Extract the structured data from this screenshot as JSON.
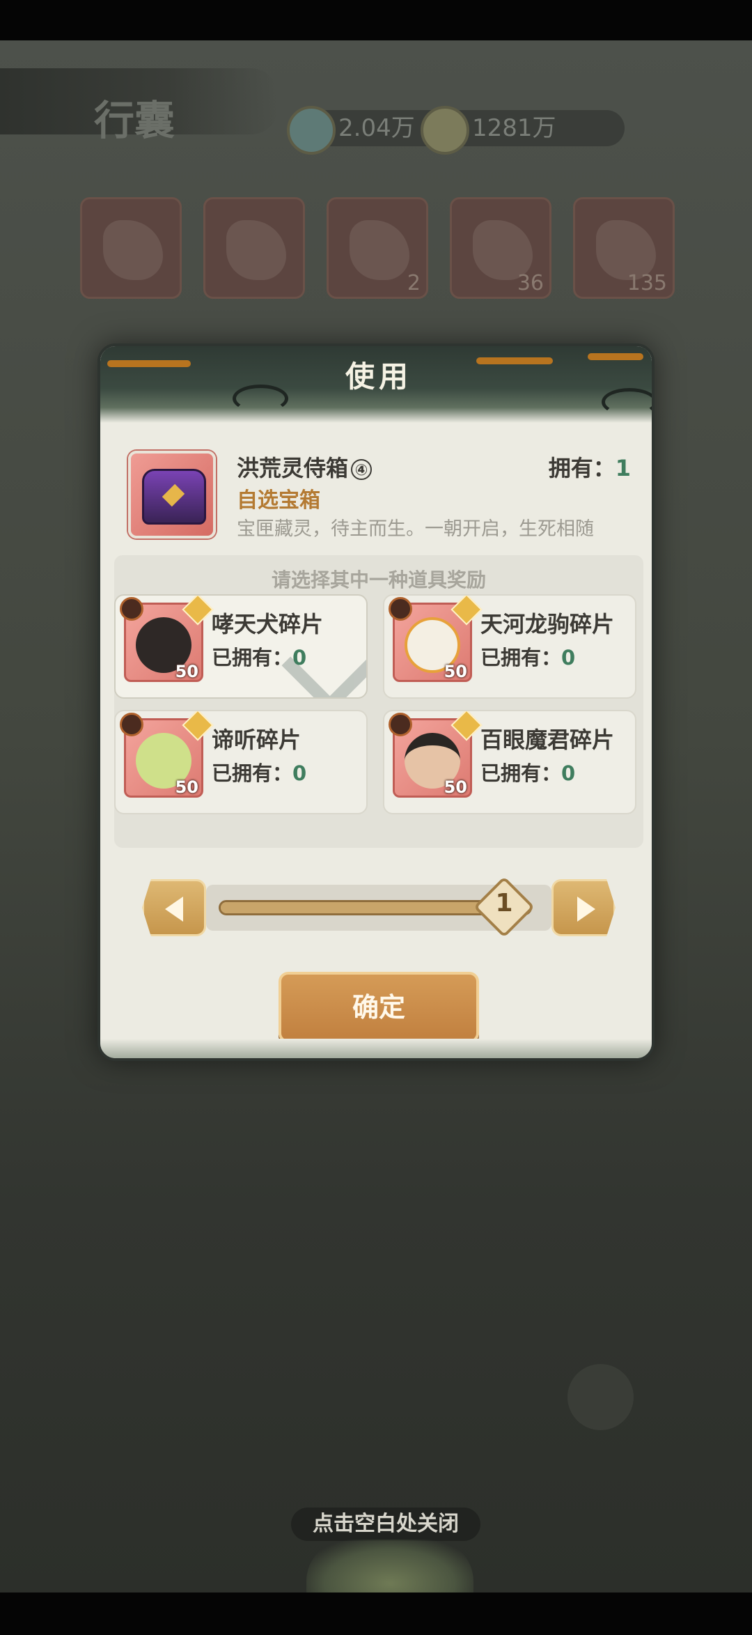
{
  "background": {
    "title": "行囊",
    "currency_1": "2.04万",
    "currency_2": "1281万",
    "slot_counts": [
      "",
      "",
      "2",
      "36",
      "135"
    ]
  },
  "dialog": {
    "title": "使用",
    "item": {
      "name": "洪荒灵侍箱",
      "badge": "④",
      "owned_label": "拥有：",
      "owned_value": "1",
      "type": "自选宝箱",
      "description": "宝匣藏灵，待主而生。一朝开启，生死相随"
    },
    "choice_title": "请选择其中一种道具奖励",
    "rewards": [
      {
        "name": "哮天犬碎片",
        "owned_label": "已拥有：",
        "owned_value": "0",
        "qty": "50",
        "selected": true
      },
      {
        "name": "天河龙驹碎片",
        "owned_label": "已拥有：",
        "owned_value": "0",
        "qty": "50",
        "selected": false
      },
      {
        "name": "谛听碎片",
        "owned_label": "已拥有：",
        "owned_value": "0",
        "qty": "50",
        "selected": false
      },
      {
        "name": "百眼魔君碎片",
        "owned_label": "已拥有：",
        "owned_value": "0",
        "qty": "50",
        "selected": false
      }
    ],
    "slider": {
      "value": "1",
      "fraction": 1.0
    },
    "confirm_label": "确定"
  },
  "close_hint": "点击空白处关闭",
  "colors": {
    "accent_gold": "#c1803f",
    "owned_green": "#3f7d5e",
    "item_type": "#b47a32"
  }
}
